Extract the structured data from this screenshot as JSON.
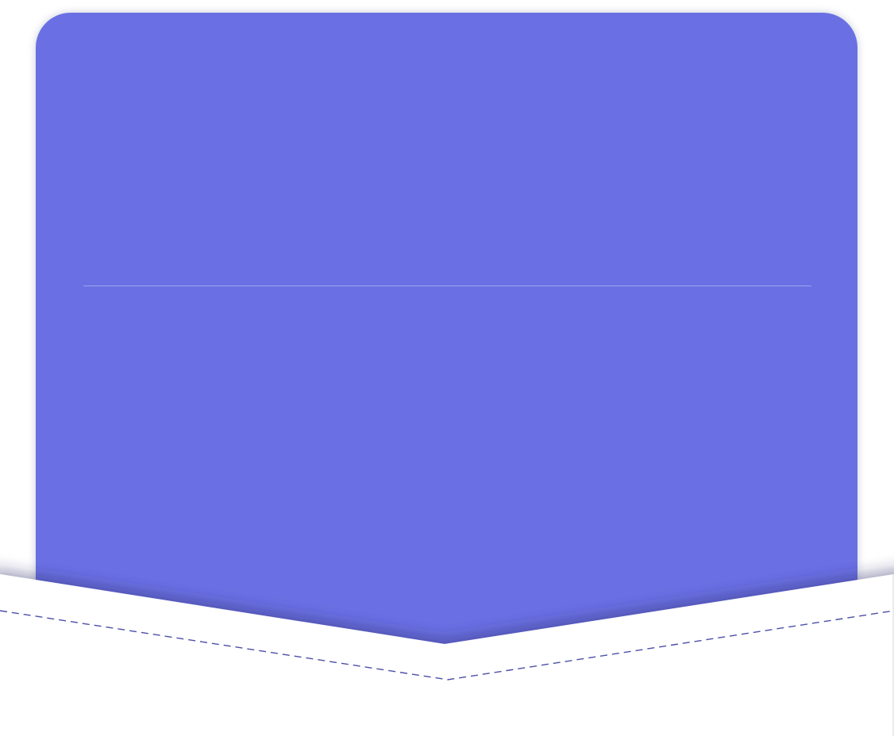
{
  "colors": {
    "card": "#6a70e3",
    "pocket": "#ffffff",
    "stitch": "#4b4fa6",
    "divider": "rgba(255,255,255,0.35)"
  },
  "pocket": {
    "style": "envelope-flap",
    "stitch": "dashed"
  }
}
